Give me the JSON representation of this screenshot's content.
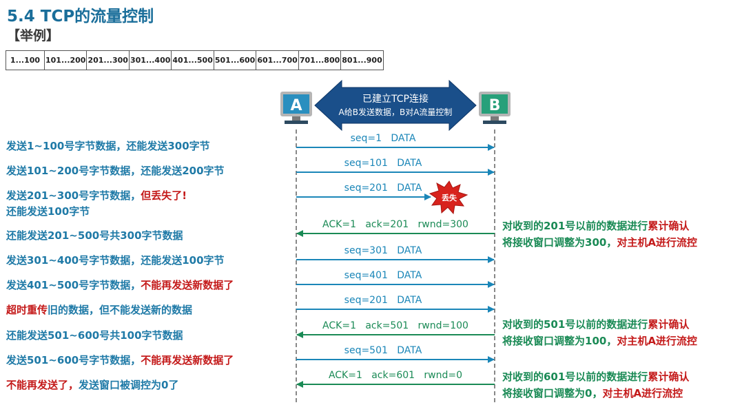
{
  "title": "5.4 TCP的流量控制",
  "subtitle": "【举例】",
  "byte_ranges": [
    "1...100",
    "101...200",
    "201...300",
    "301...400",
    "401...500",
    "501...600",
    "601...700",
    "701...800",
    "801...900"
  ],
  "hosts": {
    "a": "A",
    "b": "B"
  },
  "connection": {
    "line1": "已建立TCP连接",
    "line2": "A给B发送数据，B对A流量控制"
  },
  "lost_label": "丢失",
  "messages": [
    {
      "dir": "ab",
      "label": "seq=1   DATA"
    },
    {
      "dir": "ab",
      "label": "seq=101   DATA"
    },
    {
      "dir": "ab",
      "label": "seq=201   DATA",
      "lost": true
    },
    {
      "dir": "ba",
      "label": "ACK=1   ack=201   rwnd=300"
    },
    {
      "dir": "ab",
      "label": "seq=301   DATA"
    },
    {
      "dir": "ab",
      "label": "seq=401   DATA"
    },
    {
      "dir": "ab",
      "label": "seq=201   DATA"
    },
    {
      "dir": "ba",
      "label": "ACK=1   ack=501   rwnd=100"
    },
    {
      "dir": "ab",
      "label": "seq=501   DATA"
    },
    {
      "dir": "ba",
      "label": "ACK=1   ack=601   rwnd=0"
    }
  ],
  "left_notes": [
    [
      {
        "t": "发送1~100号字节数据，还能发送300字节",
        "c": "blue"
      }
    ],
    [
      {
        "t": "发送101~200号字节数据，还能发送200字节",
        "c": "blue"
      }
    ],
    [
      {
        "t": "发送201~300号字节数据，",
        "c": "blue"
      },
      {
        "t": "但丢失了!",
        "c": "red"
      }
    ],
    [
      {
        "t": "还能发送100字节",
        "c": "blue"
      }
    ],
    [
      {
        "t": "还能发送201~500号共300字节数据",
        "c": "blue"
      }
    ],
    [
      {
        "t": "发送301~400号字节数据，还能发送100字节",
        "c": "blue"
      }
    ],
    [
      {
        "t": "发送401~500号字节数据，",
        "c": "blue"
      },
      {
        "t": "不能再发送新数据了",
        "c": "red"
      }
    ],
    [
      {
        "t": "超时重传",
        "c": "red"
      },
      {
        "t": "旧的数据，但不能发送新的数据",
        "c": "blue"
      }
    ],
    [
      {
        "t": "还能发送501~600号共100字节数据",
        "c": "blue"
      }
    ],
    [
      {
        "t": "发送501~600号字节数据，",
        "c": "blue"
      },
      {
        "t": "不能再发送新数据了",
        "c": "red"
      }
    ],
    [
      {
        "t": "不能再发送了，",
        "c": "red"
      },
      {
        "t": "发送窗口被调控为0了",
        "c": "blue"
      }
    ]
  ],
  "right_notes": [
    [
      {
        "t": "对收到的201号以前的数据进行",
        "c": "green"
      },
      {
        "t": "累计确认",
        "c": "red"
      }
    ],
    [
      {
        "t": "将接收窗口调整为300，",
        "c": "green"
      },
      {
        "t": "对主机A进行流控",
        "c": "red"
      }
    ],
    [
      {
        "t": "对收到的501号以前的数据进行",
        "c": "green"
      },
      {
        "t": "累计确认",
        "c": "red"
      }
    ],
    [
      {
        "t": "将接收窗口调整为100，",
        "c": "green"
      },
      {
        "t": "对主机A进行流控",
        "c": "red"
      }
    ],
    [
      {
        "t": "对收到的601号以前的数据进行",
        "c": "green"
      },
      {
        "t": "累计确认",
        "c": "red"
      }
    ],
    [
      {
        "t": "将接收窗口调整为0，",
        "c": "green"
      },
      {
        "t": "对主机A进行流控",
        "c": "red"
      }
    ]
  ],
  "colors": {
    "title": "#1a6e9a",
    "blue_text": "#1f7aa7",
    "red_text": "#c41a1a",
    "green_text": "#1a8a55",
    "data_arrow": "#1a86b8",
    "ack_arrow": "#1a8a55",
    "host_a": "#2a8fbf",
    "host_b": "#27a07a",
    "banner": "#1a4f8a",
    "lost_burst": "#d8231d"
  }
}
